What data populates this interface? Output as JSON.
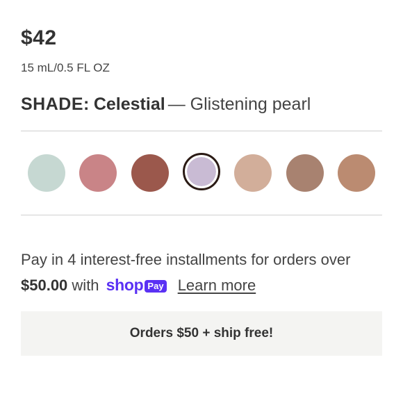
{
  "product": {
    "price": "$42",
    "size": "15 mL/0.5 FL OZ"
  },
  "shade": {
    "label": "SHADE:",
    "name": "Celestial",
    "description": "— Glistening pearl",
    "selected_index": 3,
    "swatches": [
      {
        "color": "#c6d8d2"
      },
      {
        "color": "#c98487"
      },
      {
        "color": "#9b584c"
      },
      {
        "color": "#c9bbd4"
      },
      {
        "color": "#d2ae9a"
      },
      {
        "color": "#a88270"
      },
      {
        "color": "#bb8b71"
      }
    ]
  },
  "installments": {
    "text_before": "Pay in 4 interest-free installments for orders over",
    "amount": "$50.00",
    "text_with": "with",
    "brand_shop": "shop",
    "brand_pay": "Pay",
    "learn_more": "Learn more",
    "brand_color": "#5a31f4"
  },
  "shipping_banner": {
    "text": "Orders $50 + ship free!"
  }
}
